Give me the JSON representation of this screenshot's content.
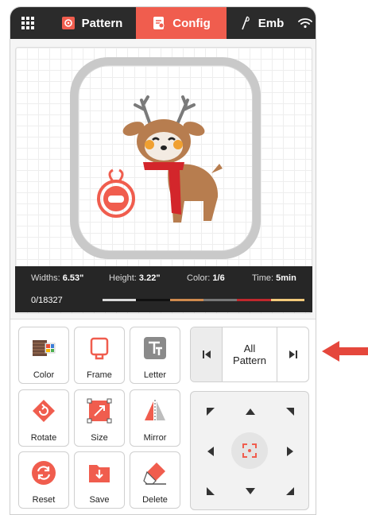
{
  "topbar": {
    "tabs": [
      {
        "label": "Pattern",
        "icon": "pattern-icon"
      },
      {
        "label": "Config",
        "icon": "config-icon",
        "active": true
      },
      {
        "label": "Emb",
        "icon": "needle-icon"
      }
    ],
    "menu_icon": "grid-menu-icon",
    "wifi_icon": "wifi-icon"
  },
  "info": {
    "widths_label": "Widths:",
    "widths_value": "6.53\"",
    "height_label": "Height:",
    "height_value": "3.22\"",
    "color_label": "Color:",
    "color_value": "1/6",
    "time_label": "Time:",
    "time_value": "5min",
    "stitch_count": "0/18327",
    "thread_colors": [
      "#d9d9d9",
      "#111111",
      "#d08a4e",
      "#777777",
      "#c0282d",
      "#f2c97a"
    ]
  },
  "tools": [
    {
      "label": "Color",
      "icon": "color-palette-icon"
    },
    {
      "label": "Frame",
      "icon": "frame-icon"
    },
    {
      "label": "Letter",
      "icon": "letter-icon"
    },
    {
      "label": "Rotate",
      "icon": "rotate-icon"
    },
    {
      "label": "Size",
      "icon": "size-icon"
    },
    {
      "label": "Mirror",
      "icon": "mirror-icon"
    },
    {
      "label": "Reset",
      "icon": "reset-icon"
    },
    {
      "label": "Save",
      "icon": "save-icon"
    },
    {
      "label": "Delete",
      "icon": "delete-icon"
    }
  ],
  "pattern_nav": {
    "line1": "All",
    "line2": "Pattern"
  },
  "colors": {
    "accent": "#f05d4e",
    "topbar": "#2b2b2b",
    "infobar": "#262626"
  }
}
